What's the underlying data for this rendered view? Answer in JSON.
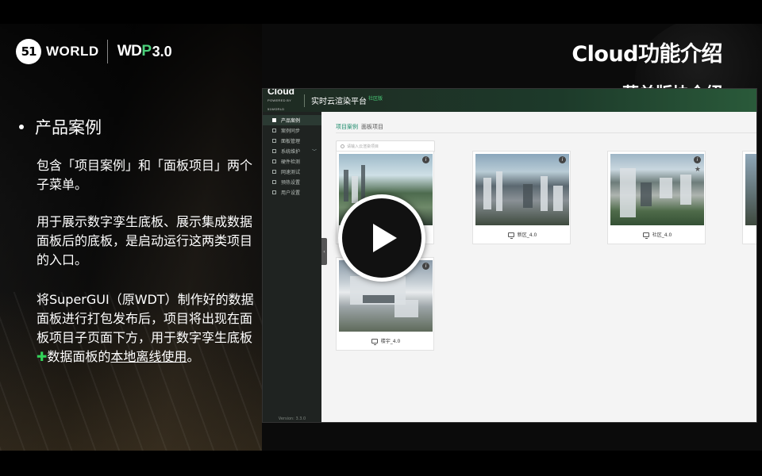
{
  "brand": {
    "logo_mark": "51",
    "logo_text": "WORLD",
    "product_pre": "WD",
    "product_o": "P",
    "product_version": "3.0"
  },
  "slide": {
    "title": "Cloud功能介绍",
    "subtitle": "菜单版块介绍",
    "bullet": "产品案例",
    "para1": "包含「项目案例」和「面板项目」两个子菜单。",
    "para2": "用于展示数字孪生底板、展示集成数据面板后的底板，是启动运行这两类项目的入口。",
    "para3_a": "将SuperGUI（原WDT）制作好的数据面板进行打包发布后，项目将出现在面板项目子页面下方，用于数字孪生底板",
    "para3_plus": "✚",
    "para3_b": "数据面板的",
    "para3_underline": "本地离线使用",
    "para3_end": "。"
  },
  "app": {
    "logo": "Cloud",
    "logo_sub": "POWERED BY 51WORLD",
    "title": "实时云渲染平台",
    "badge": "社区版",
    "sidebar": {
      "items": [
        {
          "label": "产品案例",
          "active": true
        },
        {
          "label": "案例同步"
        },
        {
          "label": "面板管理"
        },
        {
          "label": "系统维护",
          "caret": "﹀"
        },
        {
          "label": "硬件检测"
        },
        {
          "label": "网速测试"
        },
        {
          "label": "预热设置"
        },
        {
          "label": "用户设置"
        }
      ],
      "version": "Version: 3.3.0"
    },
    "tabs": [
      "项目案例",
      "面板项目"
    ],
    "search_placeholder": "请输入云渲染项目",
    "cards": [
      {
        "label": "",
        "thumb": "mountain-city"
      },
      {
        "label": "新区_4.0",
        "thumb": "new-district"
      },
      {
        "label": "社区_4.0",
        "thumb": "community"
      },
      {
        "label": "楼宇_4.0",
        "thumb": "building"
      }
    ],
    "info_glyph": "i",
    "star_glyph": "★"
  },
  "overlay": {
    "play_icon": "play-icon"
  },
  "colors": {
    "accent_green": "#33d35a",
    "header_green": "#1d3a2a",
    "tab_active": "#1a8a6a"
  }
}
